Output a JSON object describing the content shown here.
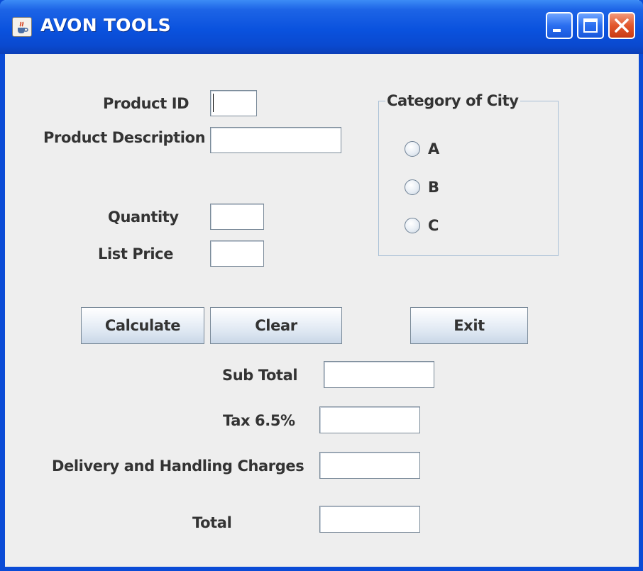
{
  "window": {
    "title": "AVON TOOLS",
    "icon": "java-cup-icon",
    "controls": [
      "minimize-icon",
      "maximize-icon",
      "close-icon"
    ]
  },
  "form": {
    "product_id": {
      "label": "Product ID",
      "value": ""
    },
    "product_description": {
      "label": "Product Description",
      "value": ""
    },
    "quantity": {
      "label": "Quantity",
      "value": ""
    },
    "list_price": {
      "label": "List Price",
      "value": ""
    }
  },
  "category": {
    "legend": "Category of City",
    "options": [
      {
        "label": "A",
        "selected": false
      },
      {
        "label": "B",
        "selected": false
      },
      {
        "label": "C",
        "selected": false
      }
    ]
  },
  "buttons": {
    "calculate": "Calculate",
    "clear": "Clear",
    "exit": "Exit"
  },
  "results": {
    "sub_total": {
      "label": "Sub Total",
      "value": ""
    },
    "tax": {
      "label": "Tax 6.5%",
      "value": ""
    },
    "delivery": {
      "label": "Delivery and Handling Charges",
      "value": ""
    },
    "total": {
      "label": "Total",
      "value": ""
    }
  },
  "colors": {
    "titlebar": "#0a52de",
    "window_border": "#0a4bd6",
    "panel_bg": "#eeeeee",
    "label_text": "#333333"
  }
}
